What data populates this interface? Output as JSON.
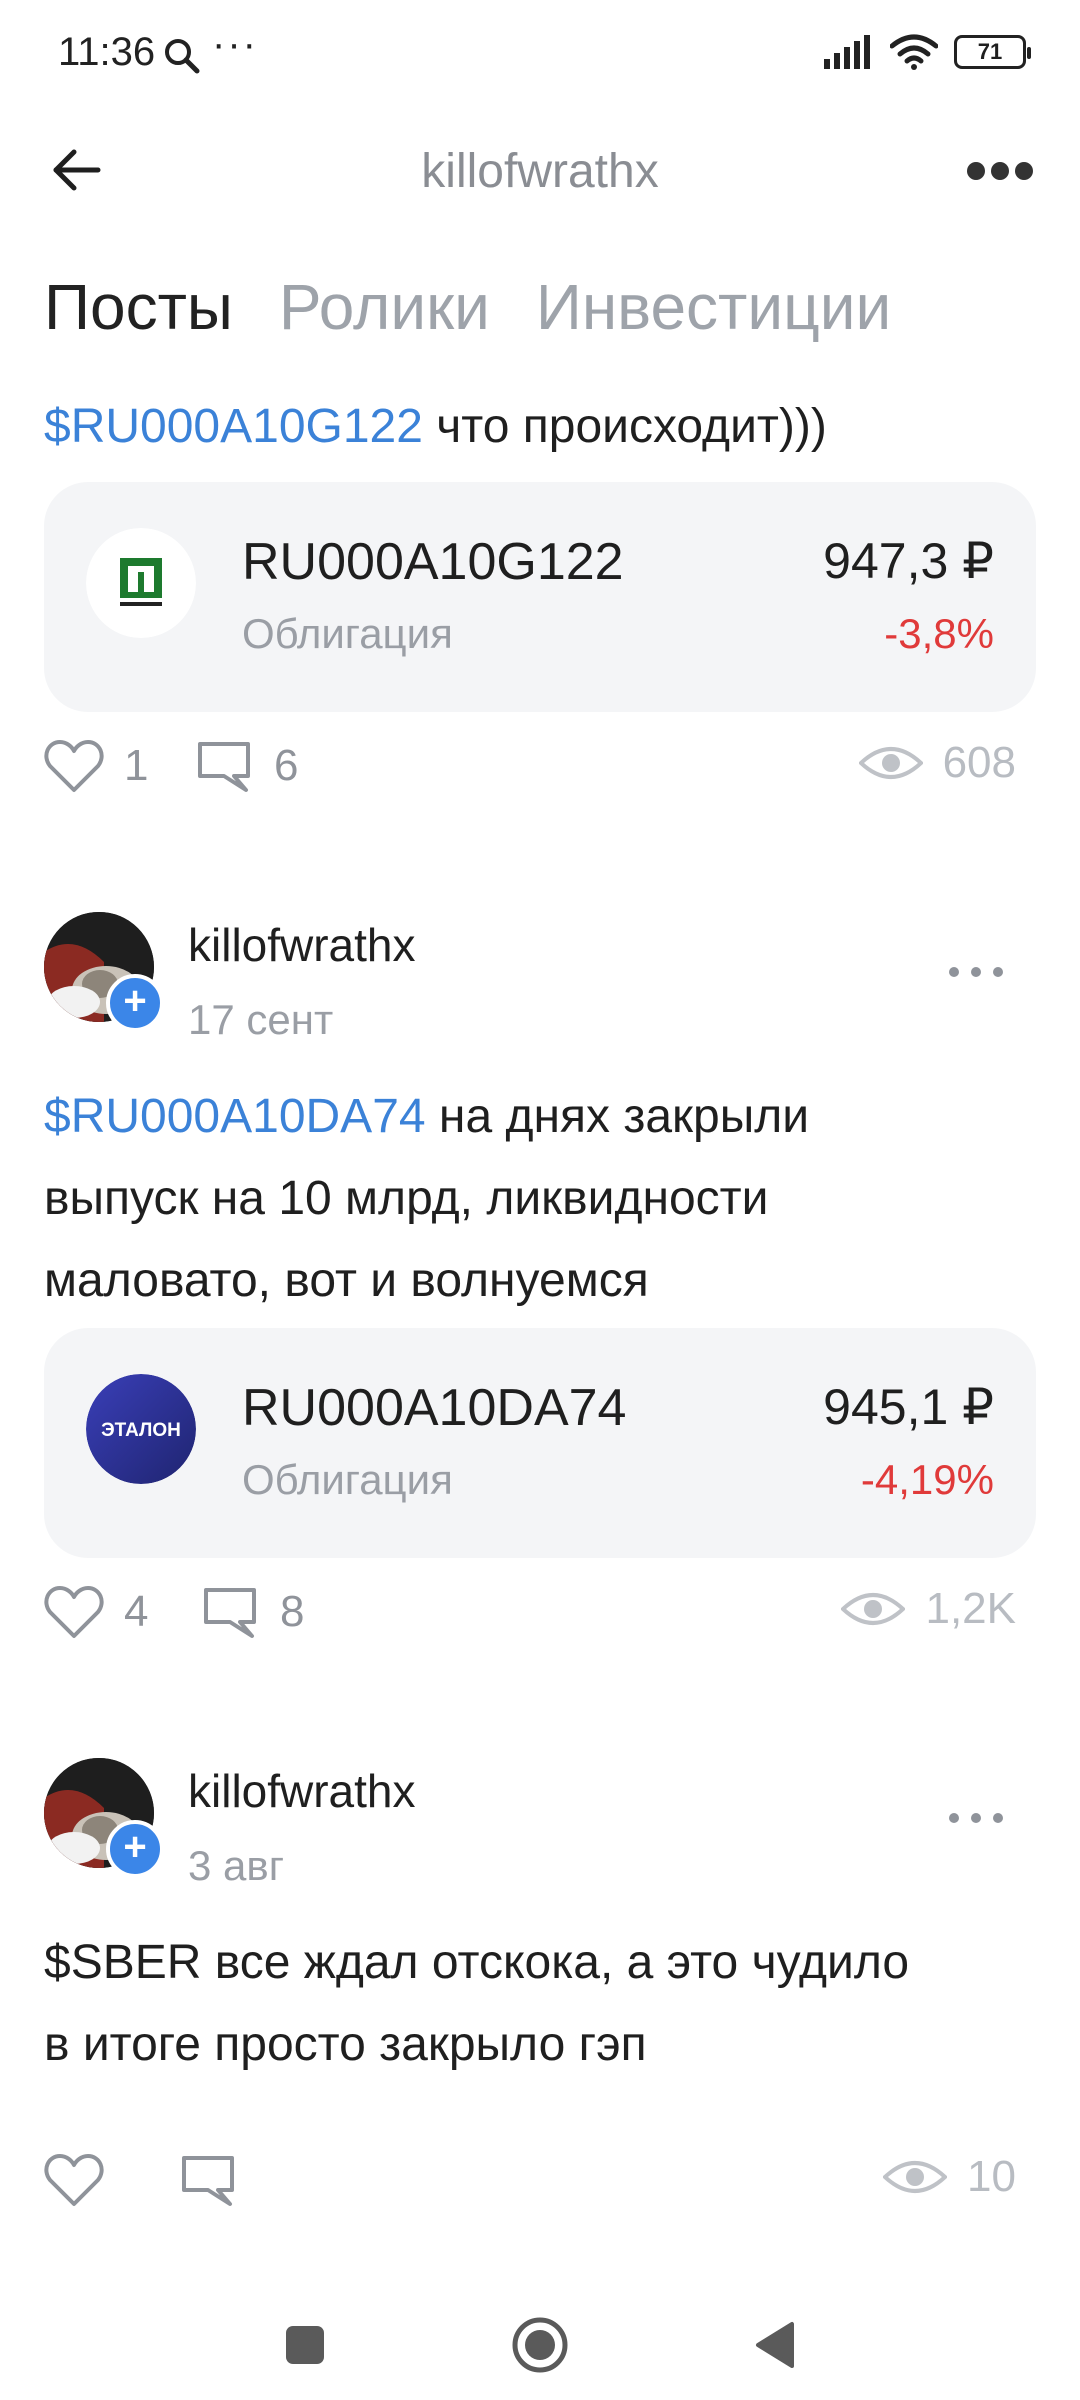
{
  "status_bar": {
    "time": "11:36",
    "dots": "···",
    "battery": "71"
  },
  "header": {
    "title": "killofwrathx"
  },
  "tabs": [
    {
      "label": "Посты",
      "active": true
    },
    {
      "label": "Ролики",
      "active": false
    },
    {
      "label": "Инвестиции",
      "active": false
    }
  ],
  "posts": [
    {
      "text_ticker": "$RU000A10G122",
      "text_rest": " что происходит)))",
      "card": {
        "ticker": "RU000A10G122",
        "type": "Облигация",
        "price": "947,3 ₽",
        "change": "-3,8%",
        "logo": "polyplast-logo"
      },
      "likes": "1",
      "comments": "6",
      "views": "608"
    },
    {
      "author": "killofwrathx",
      "date": "17 сент",
      "text_ticker": "$RU000A10DA74",
      "text_rest_line1": " на днях закрыли",
      "text_line2": "выпуск на 10 млрд, ликвидности",
      "text_line3": "маловато, вот и волнуемся",
      "card": {
        "ticker": "RU000A10DA74",
        "type": "Облигация",
        "price": "945,1 ₽",
        "change": "-4,19%",
        "logo_text": "ЭТАЛОН"
      },
      "likes": "4",
      "comments": "8",
      "views": "1,2K"
    },
    {
      "author": "killofwrathx",
      "date": "3 авг",
      "text_line1": "$SBER все ждал отскока, а это чудило",
      "text_line2": "в итоге просто закрыло гэп",
      "views": "10"
    }
  ],
  "colors": {
    "accent": "#3b82d8",
    "negative": "#e03a3a",
    "muted": "#9a9ea5",
    "card_bg": "#f4f5f7"
  }
}
